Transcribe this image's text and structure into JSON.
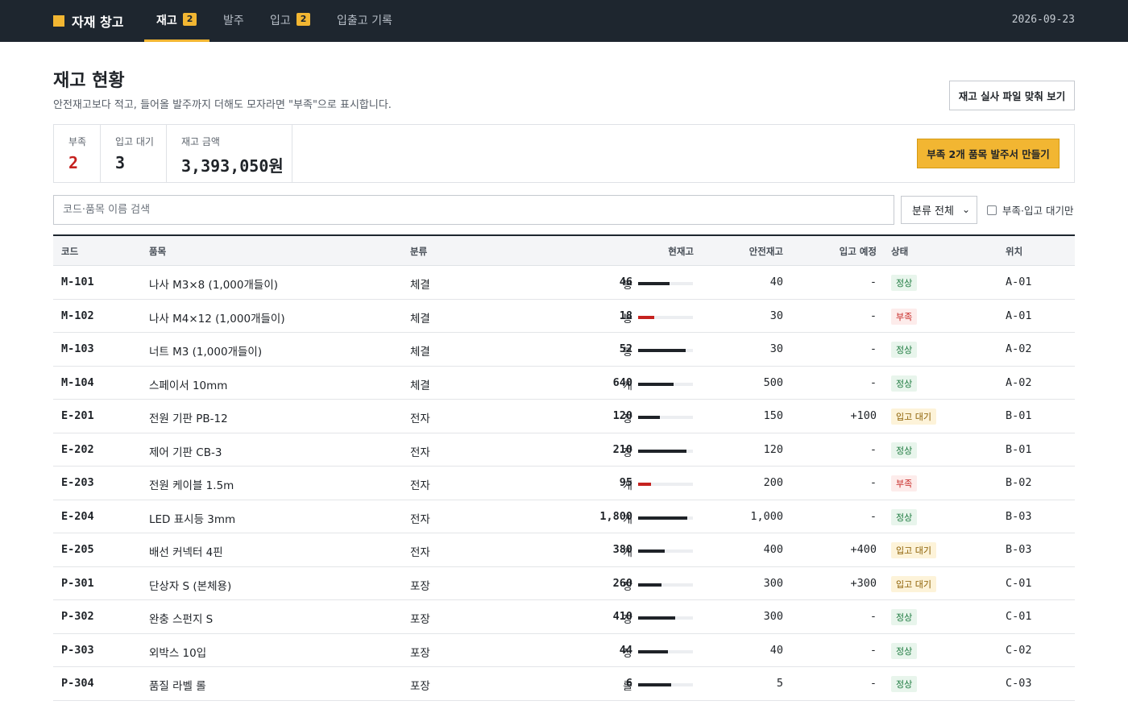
{
  "app": {
    "title": "자재 창고",
    "date": "2026-09-23"
  },
  "nav": {
    "tabs": [
      {
        "label": "재고",
        "badge": "2"
      },
      {
        "label": "발주",
        "badge": ""
      },
      {
        "label": "입고",
        "badge": "2"
      },
      {
        "label": "입출고 기록",
        "badge": ""
      }
    ],
    "active": "재고"
  },
  "header": {
    "title": "재고 현황",
    "desc": "안전재고보다 적고, 들어올 발주까지 더해도 모자라면 \"부족\"으로 표시합니다.",
    "audit_button": "재고 실사 파일 맞춰 보기"
  },
  "summary": {
    "short_label": "부족",
    "short_value": "2",
    "wait_label": "입고 대기",
    "wait_value": "3",
    "amount_label": "재고 금액",
    "amount_value": "3,393,050원",
    "order_button": "부족 2개 품목 발주서 만들기"
  },
  "filters": {
    "search_placeholder": "코드·품목 이름 검색",
    "category_selected": "분류 전체",
    "only_label": "부족·입고 대기만",
    "only_checked": false
  },
  "table": {
    "headers": {
      "code": "코드",
      "name": "품목",
      "cat": "분류",
      "stock": "현재고",
      "safe": "안전재고",
      "inc": "입고 예정",
      "status": "상태",
      "loc": "위치"
    },
    "rows": [
      {
        "code": "M-101",
        "name": "나사 M3×8 (1,000개들이)",
        "cat": "체결",
        "stock": "46",
        "unit": "봉",
        "level": 0.58,
        "safe": "40",
        "inc": "-",
        "status": "정상",
        "kind": "ok",
        "loc": "A-01"
      },
      {
        "code": "M-102",
        "name": "나사 M4×12 (1,000개들이)",
        "cat": "체결",
        "stock": "18",
        "unit": "봉",
        "level": 0.3,
        "safe": "30",
        "inc": "-",
        "status": "부족",
        "kind": "short",
        "loc": "A-01"
      },
      {
        "code": "M-103",
        "name": "너트 M3 (1,000개들이)",
        "cat": "체결",
        "stock": "52",
        "unit": "봉",
        "level": 0.87,
        "safe": "30",
        "inc": "-",
        "status": "정상",
        "kind": "ok",
        "loc": "A-02"
      },
      {
        "code": "M-104",
        "name": "스페이서 10mm",
        "cat": "체결",
        "stock": "640",
        "unit": "개",
        "level": 0.64,
        "safe": "500",
        "inc": "-",
        "status": "정상",
        "kind": "ok",
        "loc": "A-02"
      },
      {
        "code": "E-201",
        "name": "전원 기판 PB-12",
        "cat": "전자",
        "stock": "120",
        "unit": "장",
        "level": 0.4,
        "safe": "150",
        "inc": "+100",
        "status": "입고 대기",
        "kind": "wait",
        "loc": "B-01"
      },
      {
        "code": "E-202",
        "name": "제어 기판 CB-3",
        "cat": "전자",
        "stock": "210",
        "unit": "장",
        "level": 0.88,
        "safe": "120",
        "inc": "-",
        "status": "정상",
        "kind": "ok",
        "loc": "B-01"
      },
      {
        "code": "E-203",
        "name": "전원 케이블 1.5m",
        "cat": "전자",
        "stock": "95",
        "unit": "개",
        "level": 0.24,
        "safe": "200",
        "inc": "-",
        "status": "부족",
        "kind": "short",
        "loc": "B-02"
      },
      {
        "code": "E-204",
        "name": "LED 표시등 3mm",
        "cat": "전자",
        "stock": "1,800",
        "unit": "개",
        "level": 0.9,
        "safe": "1,000",
        "inc": "-",
        "status": "정상",
        "kind": "ok",
        "loc": "B-03"
      },
      {
        "code": "E-205",
        "name": "배선 커넥터 4핀",
        "cat": "전자",
        "stock": "380",
        "unit": "개",
        "level": 0.48,
        "safe": "400",
        "inc": "+400",
        "status": "입고 대기",
        "kind": "wait",
        "loc": "B-03"
      },
      {
        "code": "P-301",
        "name": "단상자 S (본체용)",
        "cat": "포장",
        "stock": "260",
        "unit": "장",
        "level": 0.43,
        "safe": "300",
        "inc": "+300",
        "status": "입고 대기",
        "kind": "wait",
        "loc": "C-01"
      },
      {
        "code": "P-302",
        "name": "완충 스펀지 S",
        "cat": "포장",
        "stock": "410",
        "unit": "장",
        "level": 0.68,
        "safe": "300",
        "inc": "-",
        "status": "정상",
        "kind": "ok",
        "loc": "C-01"
      },
      {
        "code": "P-303",
        "name": "외박스 10입",
        "cat": "포장",
        "stock": "44",
        "unit": "장",
        "level": 0.55,
        "safe": "40",
        "inc": "-",
        "status": "정상",
        "kind": "ok",
        "loc": "C-02"
      },
      {
        "code": "P-304",
        "name": "품질 라벨 롤",
        "cat": "포장",
        "stock": "6",
        "unit": "롤",
        "level": 0.6,
        "safe": "5",
        "inc": "-",
        "status": "정상",
        "kind": "ok",
        "loc": "C-03"
      }
    ]
  }
}
